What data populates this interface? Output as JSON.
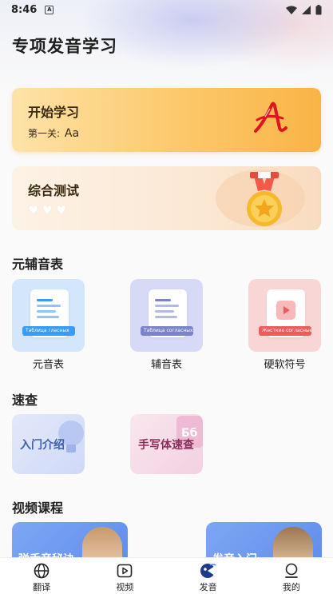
{
  "status_bar": {
    "time": "8:46",
    "notification_badge": "A"
  },
  "page_title": "专项发音学习",
  "start_card": {
    "title": "开始学习",
    "level_prefix": "第一关:",
    "level_value": "Aa",
    "icon": "letter-a-icon"
  },
  "test_card": {
    "title": "综合测试",
    "hearts": 3,
    "icon": "medal-icon"
  },
  "phonetics_section": {
    "title": "元辅音表",
    "items": [
      {
        "label": "元音表",
        "tag": "Таблица гласных",
        "bg": "#d3e6fb",
        "tag_color": "#3a9bf6"
      },
      {
        "label": "辅音表",
        "tag": "Таблица согласных",
        "bg": "#d6daf7",
        "tag_color": "#7b84c8"
      },
      {
        "label": "硬软符号",
        "tag": "Жесткие согласные",
        "bg": "#f9d6d6",
        "tag_color": "#ef5b5b"
      }
    ]
  },
  "quick_section": {
    "title": "速查",
    "items": [
      {
        "label": "入门介绍",
        "color": "#3d5fa8"
      },
      {
        "label": "手写体速查",
        "color": "#8d2f5a"
      }
    ]
  },
  "video_section": {
    "title": "视频课程",
    "items": [
      {
        "label": "弹舌音秘诀"
      },
      {
        "label": "发音入门"
      }
    ]
  },
  "bottom_nav": [
    {
      "label": "翻译",
      "icon": "globe-icon"
    },
    {
      "label": "视频",
      "icon": "play-icon"
    },
    {
      "label": "发音",
      "icon": "pronunciation-icon"
    },
    {
      "label": "我的",
      "icon": "profile-icon"
    }
  ]
}
